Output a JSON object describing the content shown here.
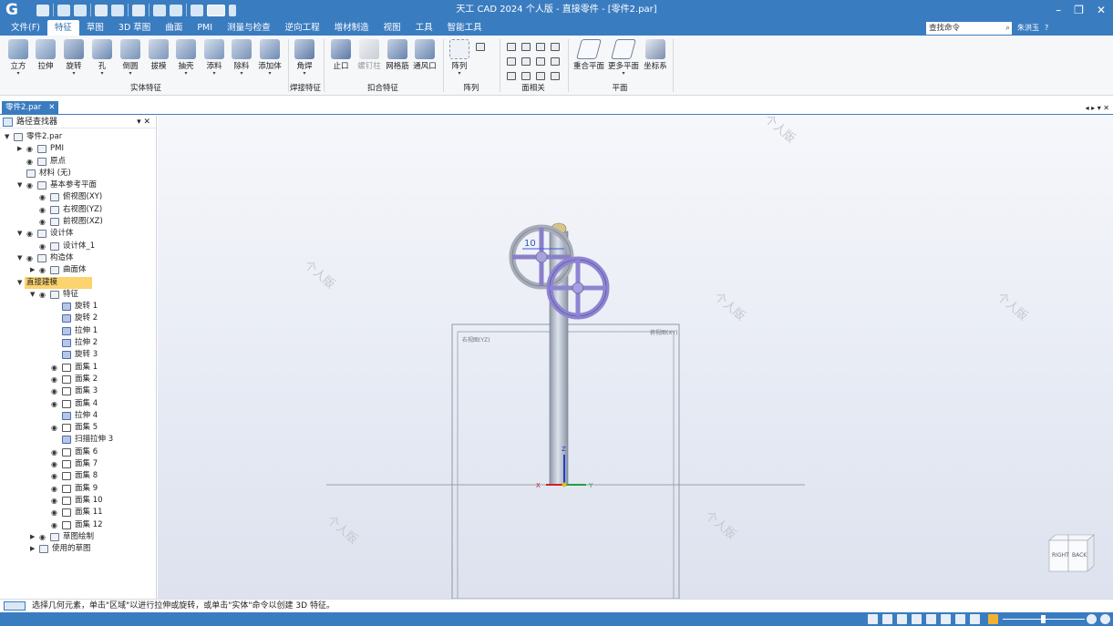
{
  "titlebar": {
    "logo": "G",
    "title": "天工 CAD 2024 个人版 - 直接零件 - [零件2.par]",
    "minimize": "–",
    "restore": "❐",
    "close": "✕"
  },
  "menu": {
    "file": "文件(F)",
    "tabs": [
      "特征",
      "草图",
      "3D 草图",
      "曲面",
      "PMI",
      "测量与检查",
      "逆向工程",
      "增材制造",
      "视图",
      "工具",
      "智能工具"
    ],
    "active_tab": "特征",
    "search_placeholder": "查找命令",
    "user": "朱洪玉",
    "help": "?"
  },
  "ribbon": {
    "buttons": [
      {
        "label": "立方",
        "dd": "▾"
      },
      {
        "label": "拉伸",
        "dd": ""
      },
      {
        "label": "旋转",
        "dd": "▾"
      },
      {
        "label": "孔",
        "dd": "▾"
      },
      {
        "label": "倒圆",
        "dd": "▾"
      },
      {
        "label": "拔模",
        "dd": ""
      },
      {
        "label": "抽壳",
        "dd": "▾"
      },
      {
        "label": "添料",
        "dd": "▾"
      },
      {
        "label": "除料",
        "dd": "▾"
      },
      {
        "label": "添加体",
        "dd": "▾"
      },
      {
        "label": "角焊",
        "dd": "▾"
      },
      {
        "label": "止口",
        "dd": ""
      },
      {
        "label": "螺钉柱",
        "dd": ""
      },
      {
        "label": "网格筋",
        "dd": ""
      },
      {
        "label": "通风口",
        "dd": ""
      },
      {
        "label": "阵列",
        "dd": "▾"
      },
      {
        "label": "重合平面",
        "dd": ""
      },
      {
        "label": "更多平面",
        "dd": "▾"
      },
      {
        "label": "坐标系",
        "dd": ""
      }
    ],
    "groups": [
      "实体特征",
      "焊接特征",
      "扣合特征",
      "阵列",
      "面相关",
      "平面"
    ]
  },
  "doc_tab": {
    "label": "零件2.par",
    "close": "✕",
    "nav": "◂ ▸ ▾ ✕"
  },
  "pathfinder": {
    "title": "路径查找器",
    "buttons": "▾ ✕",
    "items": [
      {
        "label": "零件2.par"
      },
      {
        "label": "PMI"
      },
      {
        "label": "原点"
      },
      {
        "label": "材料 (无)"
      },
      {
        "label": "基本参考平面"
      },
      {
        "label": "俯视图(XY)"
      },
      {
        "label": "右视图(YZ)"
      },
      {
        "label": "前视图(XZ)"
      },
      {
        "label": "设计体"
      },
      {
        "label": "设计体_1"
      },
      {
        "label": "构造体"
      },
      {
        "label": "曲面体"
      },
      {
        "label": "直接建模"
      },
      {
        "label": "特征"
      },
      {
        "label": "旋转 1"
      },
      {
        "label": "旋转 2"
      },
      {
        "label": "拉伸 1"
      },
      {
        "label": "拉伸 2"
      },
      {
        "label": "旋转 3"
      },
      {
        "label": "面集 1"
      },
      {
        "label": "面集 2"
      },
      {
        "label": "面集 3"
      },
      {
        "label": "面集 4"
      },
      {
        "label": "拉伸 4"
      },
      {
        "label": "面集 5"
      },
      {
        "label": "扫描拉伸 3"
      },
      {
        "label": "面集 6"
      },
      {
        "label": "面集 7"
      },
      {
        "label": "面集 8"
      },
      {
        "label": "面集 9"
      },
      {
        "label": "面集 10"
      },
      {
        "label": "面集 11"
      },
      {
        "label": "面集 12"
      },
      {
        "label": "草图绘制"
      },
      {
        "label": "使用的草图"
      }
    ]
  },
  "viewport": {
    "watermark": "个人版",
    "plane_right": "右视图(YZ)",
    "plane_top": "俯视图(XY)",
    "dimension": "10",
    "axis_x": "X",
    "axis_y": "Y",
    "axis_z": "Z",
    "cube_left": "RIGHT",
    "cube_right": "BACK"
  },
  "status": {
    "text": "选择几何元素，单击\"区域\"以进行拉伸或旋转，或单击\"实体\"命令以创建 3D 特征。"
  }
}
